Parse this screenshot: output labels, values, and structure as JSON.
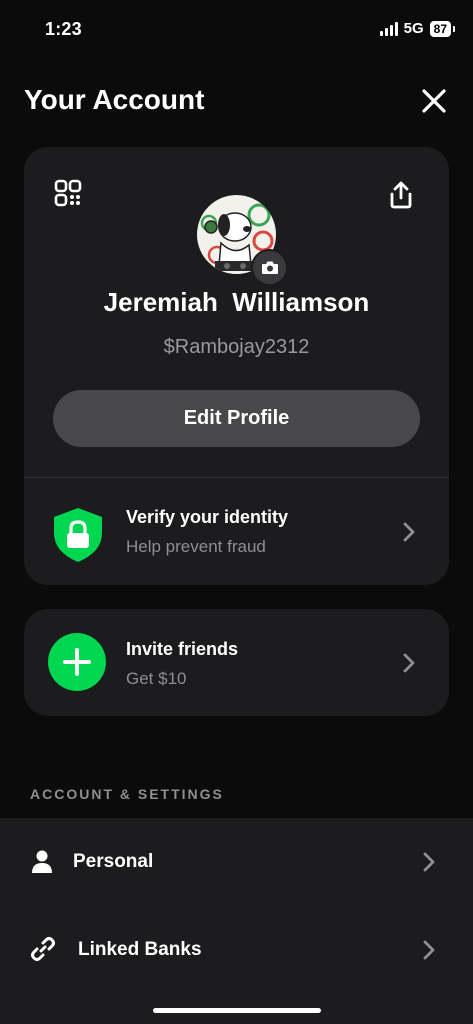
{
  "status_bar": {
    "time": "1:23",
    "network": "5G",
    "battery": "87"
  },
  "header": {
    "title": "Your Account",
    "close_icon": "close-icon"
  },
  "profile": {
    "name": "Jeremiah  Williamson",
    "cashtag": "$Rambojay2312",
    "edit_label": "Edit Profile",
    "qr_icon": "qr-code-icon",
    "share_icon": "share-icon",
    "camera_icon": "camera-icon"
  },
  "verify": {
    "title": "Verify your identity",
    "subtitle": "Help prevent fraud",
    "icon": "shield-lock-icon",
    "icon_color": "#00d64f"
  },
  "invite": {
    "title": "Invite friends",
    "subtitle": "Get $10",
    "icon": "plus-circle-icon",
    "icon_color": "#00d64f"
  },
  "settings": {
    "section_header": "ACCOUNT & SETTINGS",
    "items": [
      {
        "label": "Personal",
        "icon": "person-icon"
      },
      {
        "label": "Linked Banks",
        "icon": "link-icon"
      }
    ]
  },
  "colors": {
    "background": "#0b0b0b",
    "card": "#1c1c1e",
    "accent_green": "#00d64f",
    "muted_text": "#8e8e93"
  }
}
